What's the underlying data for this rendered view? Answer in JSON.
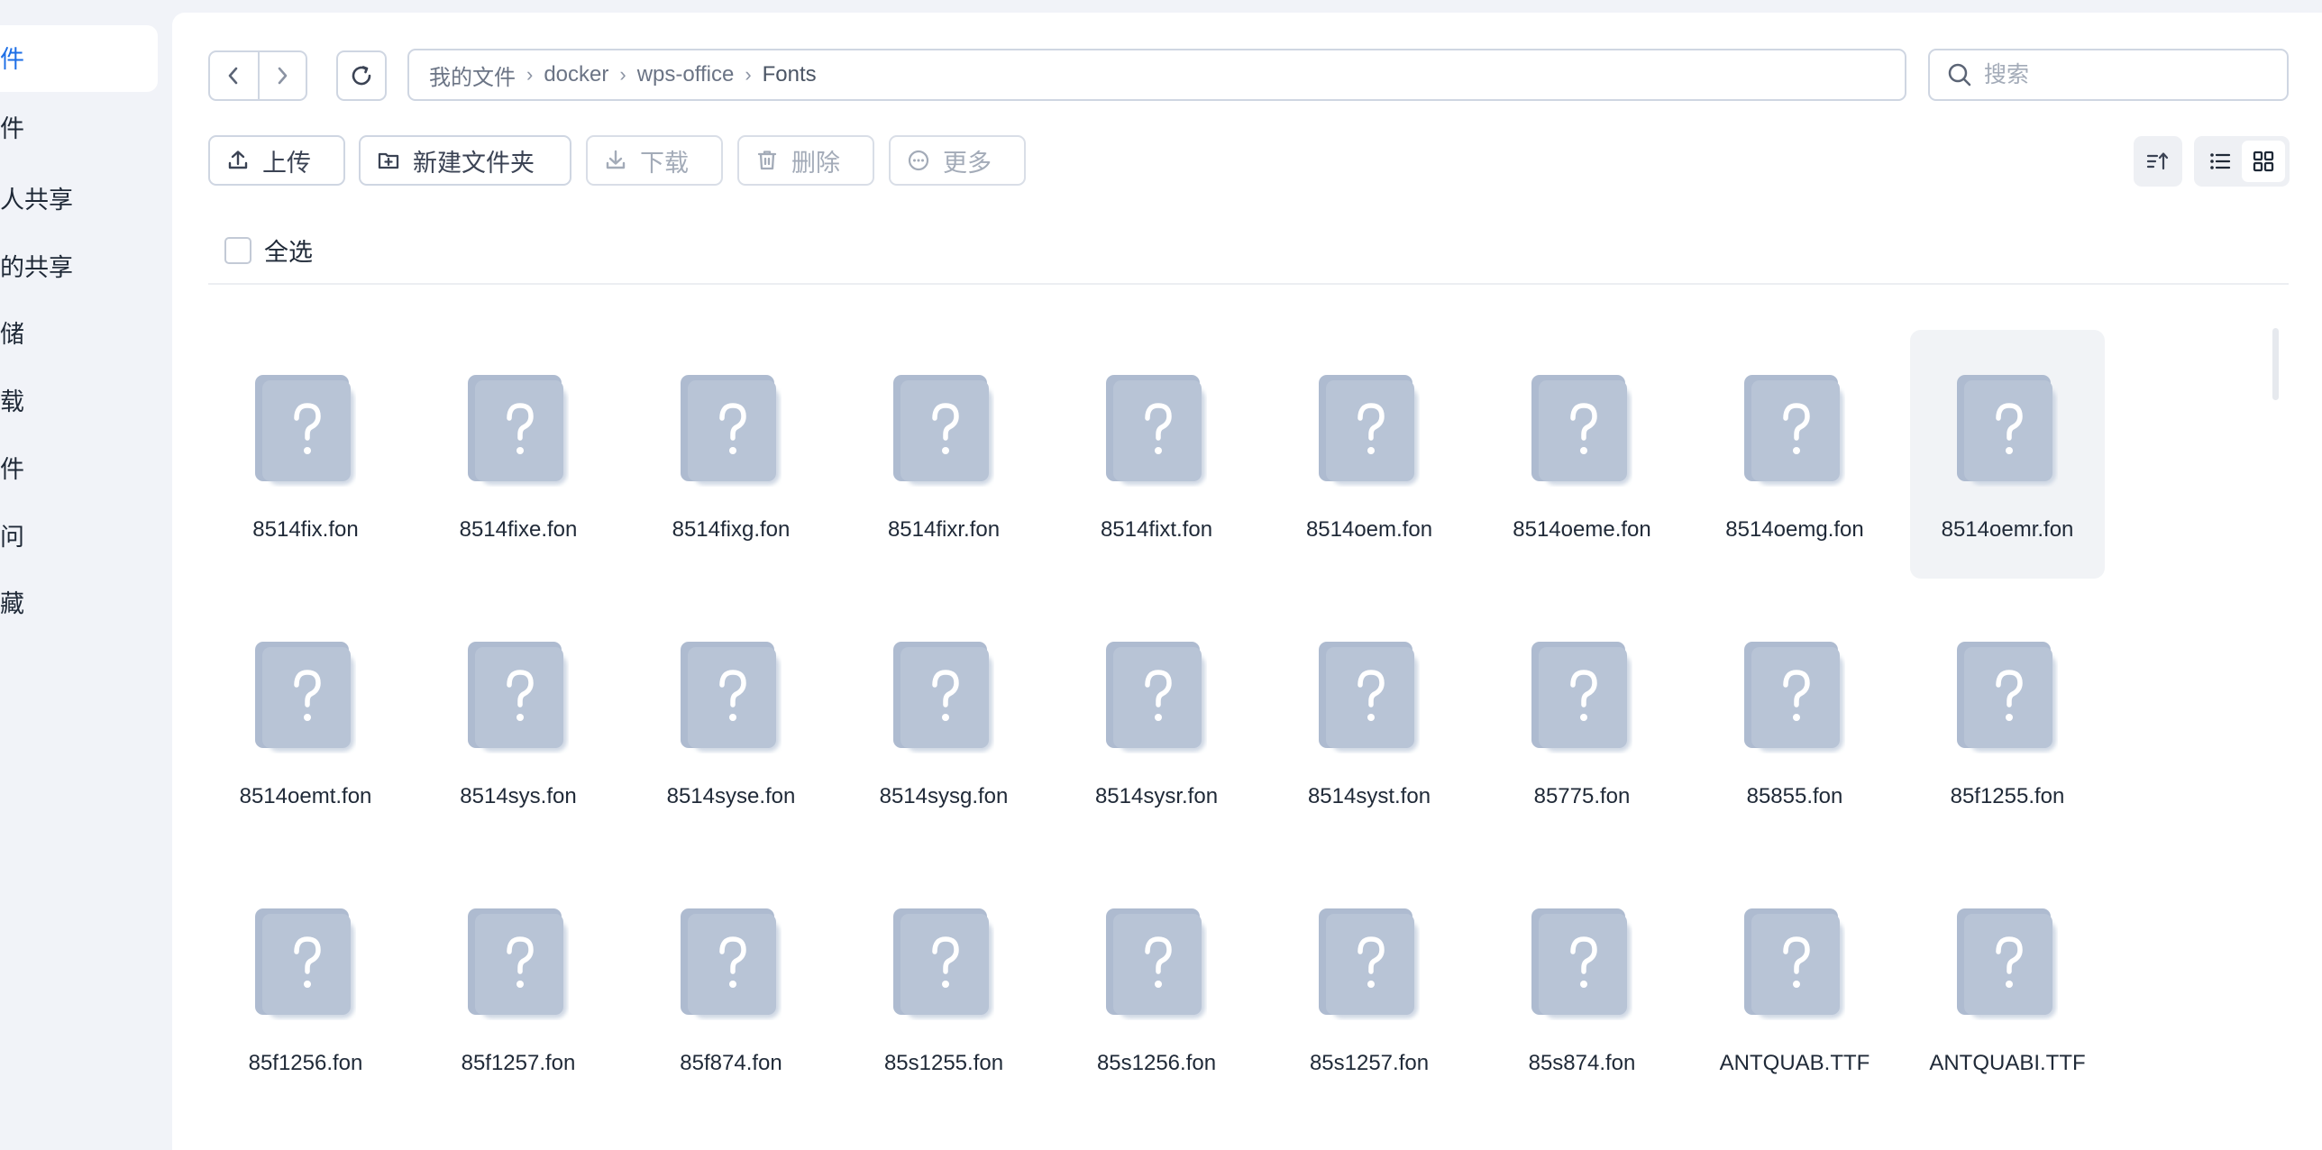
{
  "sidebar": {
    "items": [
      {
        "label": "件",
        "active": true
      },
      {
        "label": "件",
        "active": false
      },
      {
        "label": "人共享",
        "active": false
      },
      {
        "label": "的共享",
        "active": false
      },
      {
        "label": "储",
        "active": false
      },
      {
        "label": "载",
        "active": false
      },
      {
        "label": "件",
        "active": false
      },
      {
        "label": "问",
        "active": false
      },
      {
        "label": "藏",
        "active": false
      }
    ]
  },
  "nav": {
    "back_icon": "chevron-left-icon",
    "forward_icon": "chevron-right-icon",
    "refresh_icon": "refresh-icon"
  },
  "breadcrumb": {
    "items": [
      "我的文件",
      "docker",
      "wps-office",
      "Fonts"
    ]
  },
  "search": {
    "placeholder": "搜索",
    "value": ""
  },
  "toolbar": {
    "upload_label": "上传",
    "new_folder_label": "新建文件夹",
    "download_label": "下载",
    "delete_label": "删除",
    "more_label": "更多"
  },
  "select_all_label": "全选",
  "files": [
    "8514fix.fon",
    "8514fixe.fon",
    "8514fixg.fon",
    "8514fixr.fon",
    "8514fixt.fon",
    "8514oem.fon",
    "8514oeme.fon",
    "8514oemg.fon",
    "8514oemr.fon",
    "8514oemt.fon",
    "8514sys.fon",
    "8514syse.fon",
    "8514sysg.fon",
    "8514sysr.fon",
    "8514syst.fon",
    "85775.fon",
    "85855.fon",
    "85f1255.fon",
    "85f1256.fon",
    "85f1257.fon",
    "85f874.fon",
    "85s1255.fon",
    "85s1256.fon",
    "85s1257.fon",
    "85s874.fon",
    "ANTQUAB.TTF",
    "ANTQUABI.TTF"
  ],
  "highlighted_file": "8514oemr.fon",
  "colors": {
    "accent": "#1e6fe6",
    "file_icon": "#b3c0d3",
    "border": "#cfd6e2"
  }
}
